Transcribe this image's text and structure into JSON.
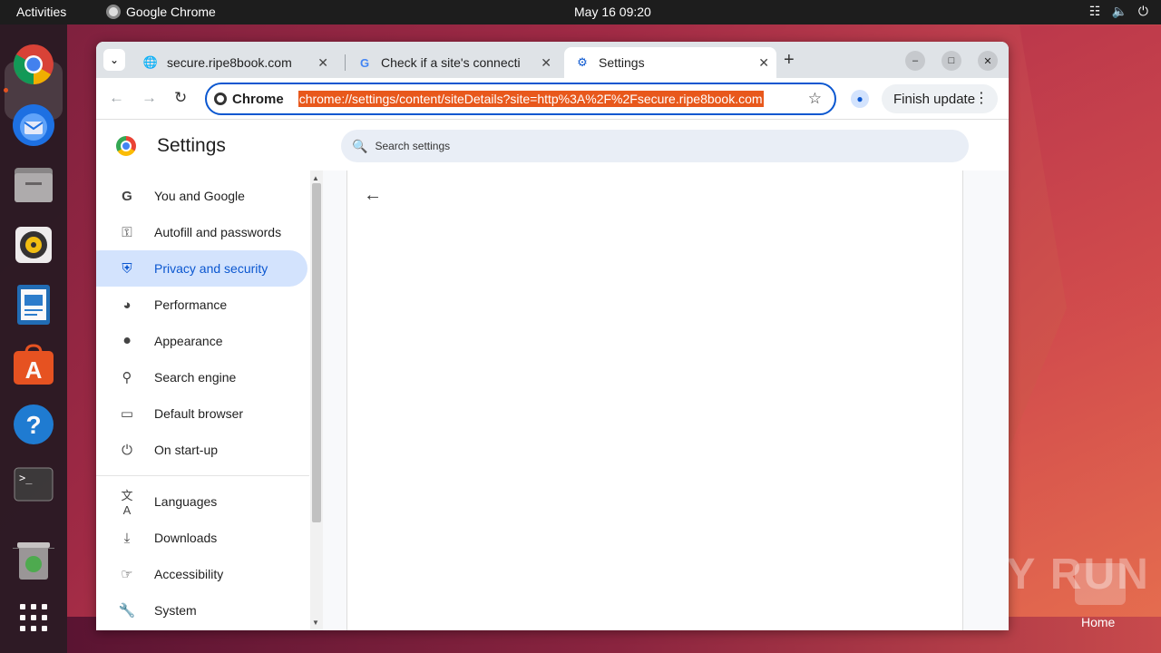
{
  "topbar": {
    "activities": "Activities",
    "app_name": "Google Chrome",
    "clock": "May 16  09:20"
  },
  "dock": {
    "items": [
      "chrome",
      "thunderbird",
      "files",
      "rhythmbox",
      "writer",
      "app-center",
      "help",
      "terminal",
      "trash",
      "app-grid"
    ]
  },
  "tabs": [
    {
      "title": "secure.ripe8book.com",
      "icon": "globe-icon"
    },
    {
      "title": "Check if a site's connecti",
      "icon": "google-icon"
    },
    {
      "title": "Settings",
      "icon": "gear-icon"
    }
  ],
  "toolbar": {
    "chip_label": "Chrome",
    "url": "chrome://settings/content/siteDetails?site=http%3A%2F%2Fsecure.ripe8book.com",
    "finish_update": "Finish update"
  },
  "settings": {
    "title": "Settings",
    "search_placeholder": "Search settings",
    "nav": [
      {
        "label": "You and Google",
        "icon": "google-g-icon"
      },
      {
        "label": "Autofill and passwords",
        "icon": "key-icon"
      },
      {
        "label": "Privacy and security",
        "icon": "shield-icon"
      },
      {
        "label": "Performance",
        "icon": "speedometer-icon"
      },
      {
        "label": "Appearance",
        "icon": "palette-icon"
      },
      {
        "label": "Search engine",
        "icon": "search-icon"
      },
      {
        "label": "Default browser",
        "icon": "browser-window-icon"
      },
      {
        "label": "On start-up",
        "icon": "power-icon"
      },
      {
        "label": "Languages",
        "icon": "translate-icon"
      },
      {
        "label": "Downloads",
        "icon": "download-icon"
      },
      {
        "label": "Accessibility",
        "icon": "accessibility-icon"
      },
      {
        "label": "System",
        "icon": "wrench-icon"
      }
    ],
    "active_index": 2
  },
  "desktop": {
    "watermark": "ANY RUN",
    "home_label": "Home"
  },
  "colors": {
    "accent": "#0b57d0",
    "url_highlight": "#e8581c",
    "active_nav_bg": "#d3e3fd"
  }
}
